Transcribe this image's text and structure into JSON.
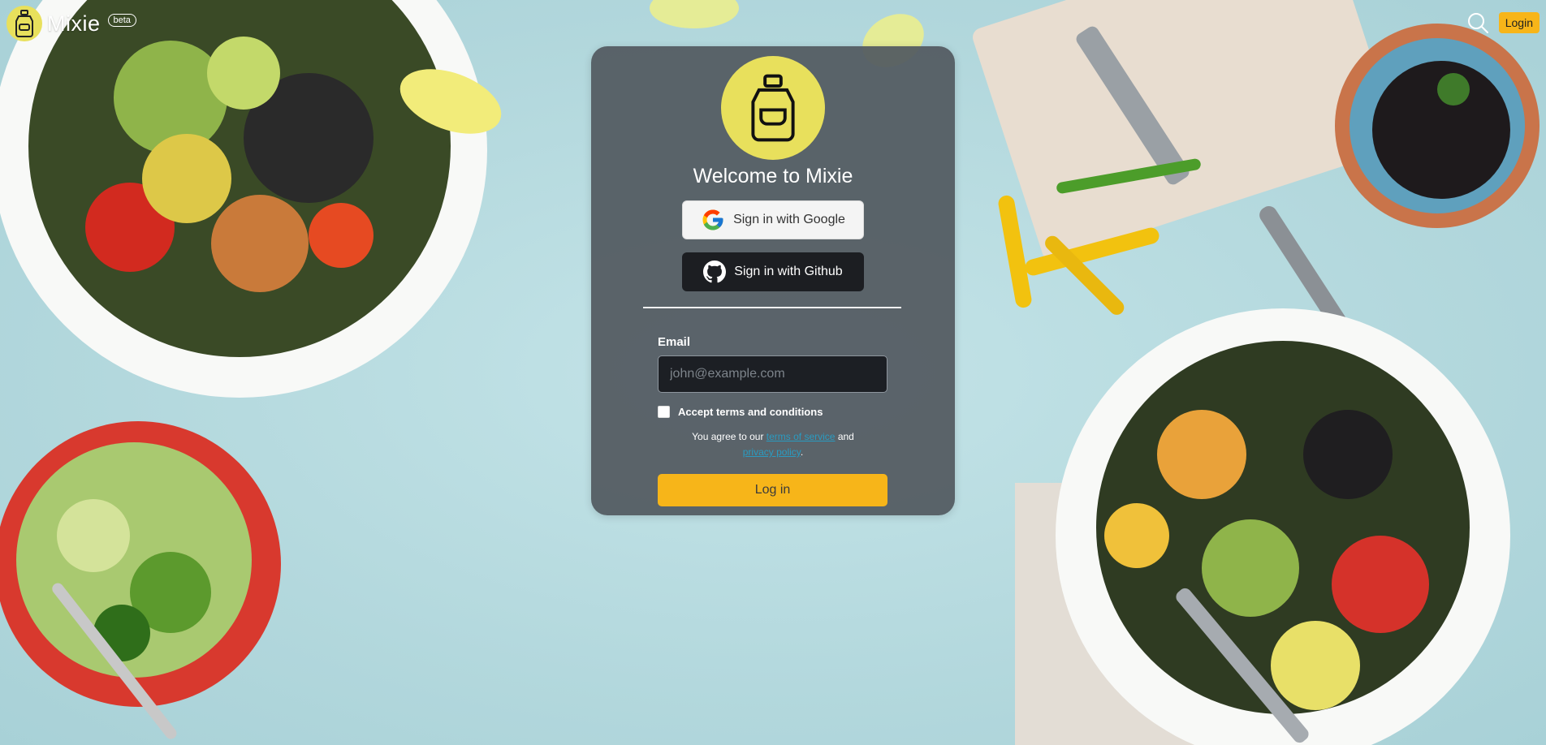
{
  "nav": {
    "brand_name": "Mixie",
    "beta_label": "beta",
    "login_label": "Login"
  },
  "card": {
    "title": "Welcome to Mixie",
    "google_label": "Sign in with Google",
    "github_label": "Sign in with Github",
    "email_label": "Email",
    "email_placeholder": "john@example.com",
    "email_value": "",
    "terms_label": "Accept terms and conditions",
    "agree_prefix": "You agree to our",
    "terms_link": "terms of service",
    "agree_and": "and",
    "privacy_link": "privacy policy",
    "agree_suffix": ".",
    "submit_label": "Log in"
  },
  "colors": {
    "accent": "#f7b519",
    "logo_bg": "#e8e05c",
    "card_bg": "#525960",
    "background": "#b8dde2",
    "link": "#2a9bc1"
  },
  "icons": [
    "mixie-bottle-icon",
    "search-icon",
    "google-icon",
    "github-icon"
  ]
}
